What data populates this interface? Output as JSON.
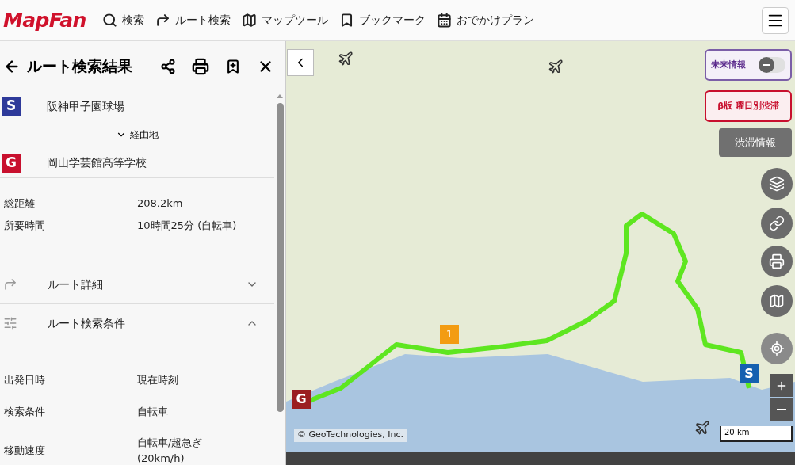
{
  "header": {
    "logo": "MapFan",
    "nav": [
      {
        "kind": "search",
        "label": "検索"
      },
      {
        "kind": "route",
        "label": "ルート検索"
      },
      {
        "kind": "map",
        "label": "マップツール"
      },
      {
        "kind": "bookmark",
        "label": "ブックマーク"
      },
      {
        "kind": "calendar",
        "label": "おでかけプラン"
      }
    ]
  },
  "panel": {
    "title": "ルート検索結果",
    "start": {
      "badge": "S",
      "name": "阪神甲子園球場"
    },
    "via": {
      "label": "経由地",
      "expanded": false
    },
    "goal": {
      "badge": "G",
      "name": "岡山学芸館高等学校"
    },
    "summary": [
      {
        "label": "総距離",
        "value": "208.2km"
      },
      {
        "label": "所要時間",
        "value": "10時間25分 (自転車)"
      }
    ],
    "sections": [
      {
        "kind": "route",
        "label": "ルート詳細",
        "expanded": false
      },
      {
        "kind": "conditions",
        "label": "ルート検索条件",
        "expanded": true
      }
    ],
    "conditions": [
      {
        "label": "出発日時",
        "value": "現在時刻"
      },
      {
        "label": "検索条件",
        "value": "自転車"
      },
      {
        "label": "移動速度",
        "value": "自転車/超急ぎ\n(20km/h)"
      }
    ]
  },
  "map": {
    "future_info": {
      "label": "未来情報",
      "on": false
    },
    "beta_traffic": "β版 曜日別渋滞",
    "traffic": "渋滞情報",
    "start_pin": "S",
    "goal_pin": "G",
    "waypoint_pin": "1",
    "scale": "20 km",
    "copyright": "© GeoTechnologies, Inc."
  }
}
